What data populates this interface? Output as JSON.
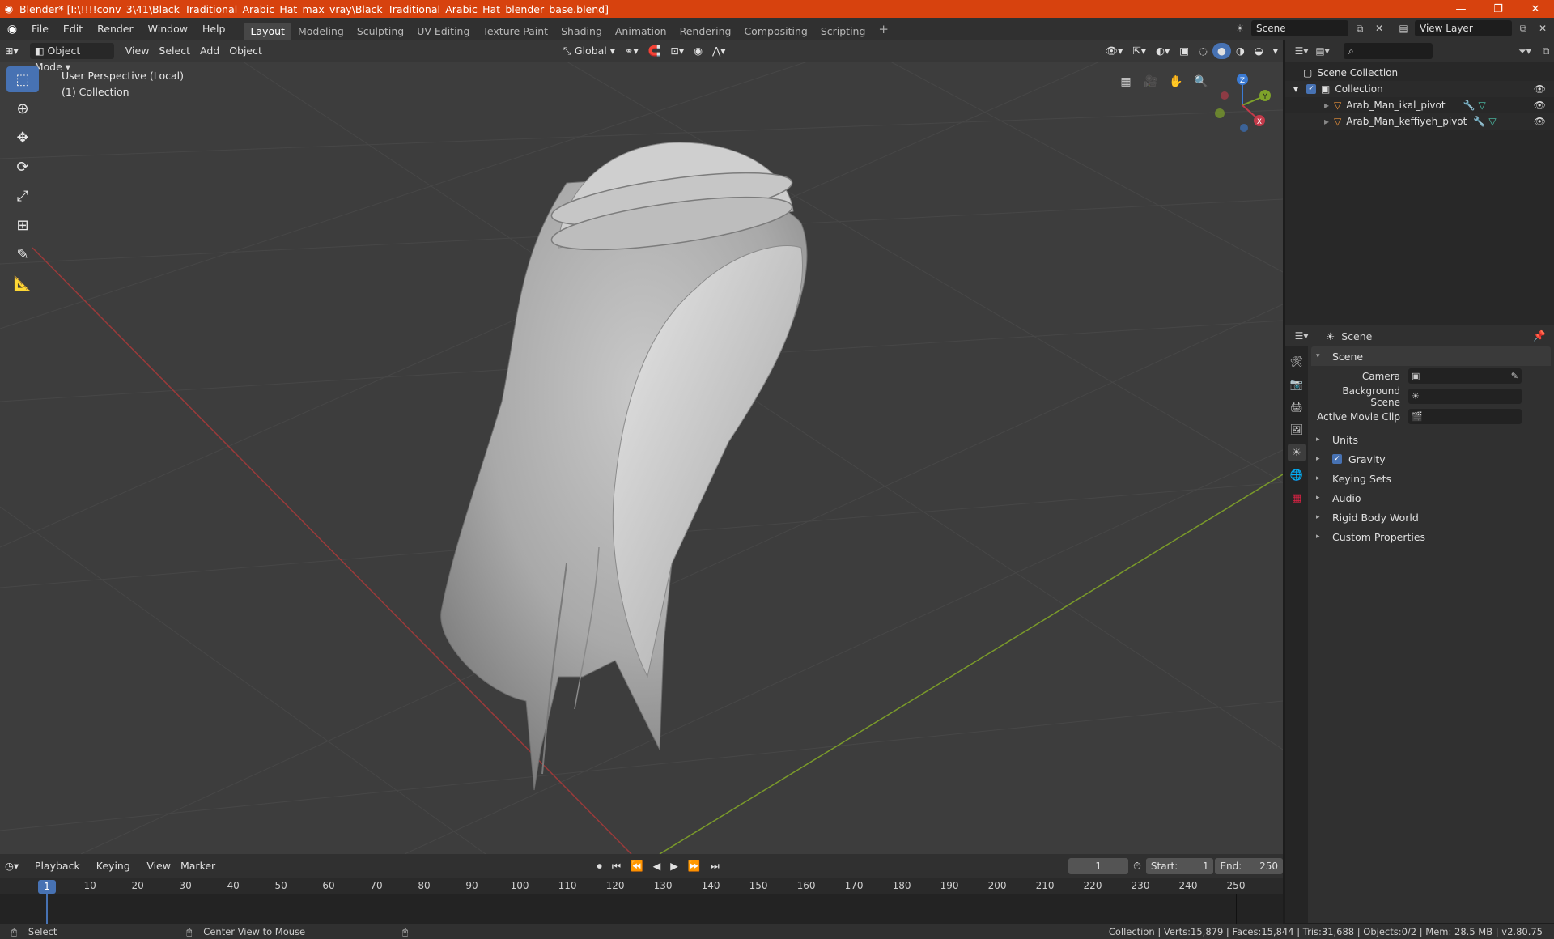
{
  "titlebar": {
    "title": "Blender* [I:\\!!!!conv_3\\41\\Black_Traditional_Arabic_Hat_max_vray\\Black_Traditional_Arabic_Hat_blender_base.blend]"
  },
  "menu": {
    "file": "File",
    "edit": "Edit",
    "render": "Render",
    "window": "Window",
    "help": "Help"
  },
  "workspaces": [
    "Layout",
    "Modeling",
    "Sculpting",
    "UV Editing",
    "Texture Paint",
    "Shading",
    "Animation",
    "Rendering",
    "Compositing",
    "Scripting"
  ],
  "scene_selector": {
    "scene": "Scene",
    "view_layer": "View Layer"
  },
  "viewport": {
    "mode": "Object Mode",
    "menus": [
      "View",
      "Select",
      "Add",
      "Object"
    ],
    "orientation": "Global",
    "info_line1": "User Perspective (Local)",
    "info_line2": "(1) Collection",
    "gizmo": {
      "x": "X",
      "y": "Y",
      "z": "Z"
    }
  },
  "outliner": {
    "root": "Scene Collection",
    "collection": "Collection",
    "objects": [
      "Arab_Man_ikal_pivot",
      "Arab_Man_keffiyeh_pivot"
    ]
  },
  "properties": {
    "header": "Scene",
    "section": "Scene",
    "camera_label": "Camera",
    "bg_scene_label": "Background Scene",
    "movie_clip_label": "Active Movie Clip",
    "panels": [
      "Units",
      "Gravity",
      "Keying Sets",
      "Audio",
      "Rigid Body World",
      "Custom Properties"
    ]
  },
  "timeline": {
    "menus": [
      "Playback",
      "Keying",
      "View",
      "Marker"
    ],
    "current_frame": "1",
    "start_label": "Start:",
    "start": "1",
    "end_label": "End:",
    "end": "250",
    "ticks": [
      "10",
      "20",
      "30",
      "40",
      "50",
      "60",
      "70",
      "80",
      "90",
      "100",
      "110",
      "120",
      "130",
      "140",
      "150",
      "160",
      "170",
      "180",
      "190",
      "200",
      "210",
      "220",
      "230",
      "240",
      "250"
    ],
    "cursor_label": "1"
  },
  "statusbar": {
    "select": "Select",
    "center": "Center View to Mouse",
    "stats": "Collection | Verts:15,879 | Faces:15,844 | Tris:31,688 | Objects:0/2 | Mem: 28.5 MB | v2.80.75"
  },
  "colors": {
    "accent": "#4772b3",
    "titlebar": "#d7420e",
    "x_axis": "#9b3a3a",
    "y_axis": "#7a9a2a"
  }
}
